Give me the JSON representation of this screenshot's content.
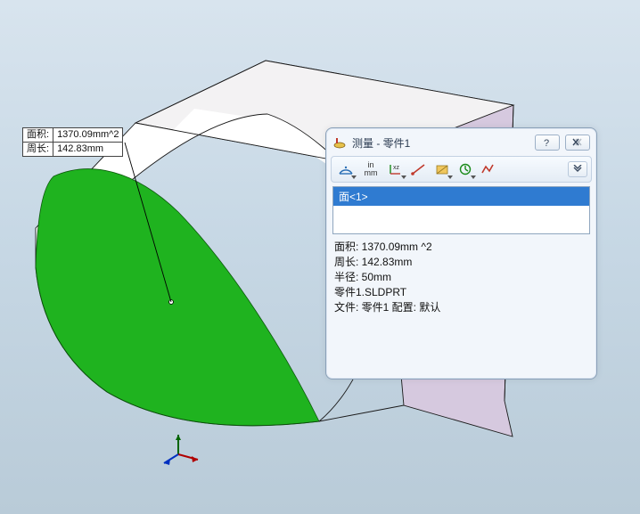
{
  "callout": {
    "area_label": "面积:",
    "area_value": "1370.09mm^2",
    "perimeter_label": "周长:",
    "perimeter_value": "142.83mm"
  },
  "dialog": {
    "title": "测量 - 零件1",
    "selection": "面<1>",
    "results": {
      "area": "面积: 1370.09mm ^2",
      "perimeter": "周长: 142.83mm",
      "radius": "半径: 50mm",
      "part": "零件1.SLDPRT",
      "file": "文件: 零件1 配置: 默认"
    },
    "units_top": "in",
    "units_bot": "mm"
  },
  "triad": {
    "x": "x",
    "y": "y",
    "z": "z"
  }
}
